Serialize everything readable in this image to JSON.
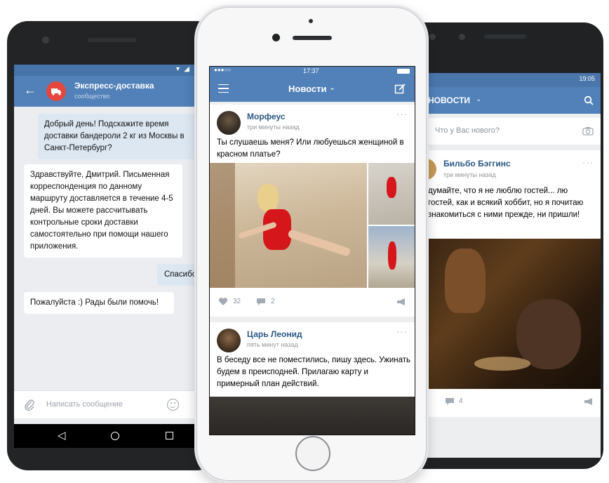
{
  "colors": {
    "accent": "#5181b8",
    "bubble_out": "#dde7f2",
    "bubble_in": "#ffffff",
    "background": "#ebedf0"
  },
  "android_chat": {
    "header_title": "Экспресс-доставка",
    "header_subtitle": "сообщество",
    "messages": [
      {
        "from": "me",
        "text": "Добрый день! Подскажите время доставки бандероли 2 кг из Москвы в Санкт-Петербург?"
      },
      {
        "from": "them",
        "text": "Здравствуйте, Дмитрий. Письменная корреспонденция по данному маршруту доставляется в течение 4-5 дней. Вы можете рассчитывать контрольные сроки доставки самостоятельно при помощи нашего приложения."
      },
      {
        "from": "me",
        "text": "Спасибо"
      },
      {
        "from": "them",
        "text": "Пожалуйста :) Рады были помочь!"
      }
    ],
    "input_placeholder": "Написать сообщение"
  },
  "iphone_feed": {
    "status_time": "17:37",
    "header_title": "Новости",
    "posts": [
      {
        "author": "Морфеус",
        "time": "три минуты назад",
        "text": "Ты слушаешь меня? Или любуешься женщиной в красном платье?",
        "likes": "32",
        "comments": "2"
      },
      {
        "author": "Царь Леонид",
        "time": "пять минут назад",
        "text": "В беседу все не поместились, пишу здесь. Ужинать будем в преисподней. Прилагаю карту и примерный план действий."
      }
    ]
  },
  "android_feed": {
    "status_time": "19:05",
    "header_title": "НОВОСТИ",
    "compose_placeholder": "Что у Вас нового?",
    "post": {
      "author": "Бильбо Бэггинс",
      "time": "три минуты назад",
      "text": "думайте, что я не люблю гостей... лю гостей, как и всякий хоббит, но я почитаю знакомиться с ними прежде, ни пришли!",
      "comments": "4"
    }
  }
}
